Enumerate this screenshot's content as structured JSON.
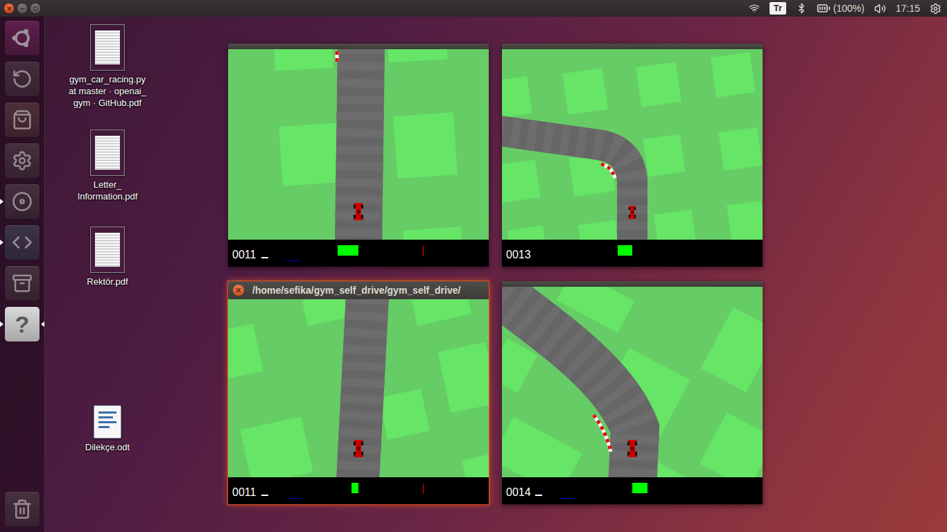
{
  "top_bar": {
    "keyboard": "Tr",
    "battery": "(100%)",
    "clock": "17:15"
  },
  "launcher": {
    "items": [
      {
        "kind": "ubuntu",
        "running": false,
        "focused": false
      },
      {
        "kind": "updater",
        "running": false,
        "focused": false
      },
      {
        "kind": "software",
        "running": false,
        "focused": false
      },
      {
        "kind": "settings",
        "running": false,
        "focused": false
      },
      {
        "kind": "disc",
        "running": true,
        "focused": false
      },
      {
        "kind": "vscode",
        "running": true,
        "focused": false
      },
      {
        "kind": "files",
        "running": false,
        "focused": false
      },
      {
        "kind": "unknown",
        "glyph": "?",
        "running": true,
        "focused": true
      }
    ],
    "trash": {
      "kind": "trash",
      "running": false,
      "focused": false
    }
  },
  "desktop_icons": [
    {
      "kind": "pdf",
      "lines": [
        "gym_car_racing.py",
        "at master · openai_",
        "gym · GitHub.pdf"
      ]
    },
    {
      "kind": "pdf",
      "lines": [
        "Letter_",
        "Information.pdf"
      ]
    },
    {
      "kind": "pdf",
      "lines": [
        "Rektör.pdf"
      ]
    },
    {
      "kind": "odt",
      "lines": [
        "Dilekçe.odt"
      ]
    }
  ],
  "windows": [
    {
      "kind": "compact",
      "focused": false,
      "score": "0011",
      "speed": 0.02,
      "abs": [
        0.01,
        0.01,
        0.01,
        0.01
      ],
      "steering": {
        "level": 0.3,
        "side": "left"
      },
      "gyro": 0.01
    },
    {
      "kind": "compact",
      "focused": false,
      "score": "0013",
      "speed": 0,
      "abs": [
        0,
        0,
        0,
        0
      ],
      "steering": {
        "level": 0.21,
        "side": "left"
      },
      "gyro": 0
    },
    {
      "kind": "full",
      "title": "/home/sefika/gym_self_drive/gym_self_drive/",
      "focused": true,
      "score": "0011",
      "speed": 0.02,
      "abs": [
        0.01,
        0.01,
        0.01,
        0.01
      ],
      "steering": {
        "level": 0.1,
        "side": "left"
      },
      "gyro": 0.01
    },
    {
      "kind": "compact",
      "focused": false,
      "score": "0014",
      "speed": 0.02,
      "abs": [
        0.01,
        0.01,
        0.01,
        0.01
      ],
      "steering": {
        "level": 0.22,
        "side": "right"
      },
      "gyro": 0
    }
  ]
}
